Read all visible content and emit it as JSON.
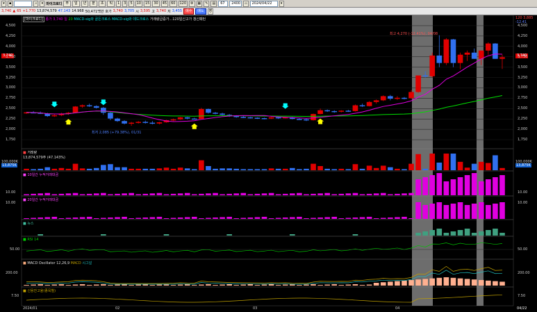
{
  "toolbar1": {
    "code": "",
    "stock_name": "마이크로디",
    "buttons": [
      "주",
      "일",
      "년",
      "분",
      "초",
      "틱"
    ],
    "periods": [
      "1",
      "3",
      "5",
      "10",
      "15",
      "30",
      "45",
      "60",
      "120"
    ],
    "count": "67",
    "count_unit": "2400",
    "date": "2024/04/22"
  },
  "toolbar2": {
    "price": "3,740",
    "change": "65",
    "change_pct": "+1.770",
    "volume": "13,874,579",
    "vol_ratio": "47.143",
    "amount": "14.968",
    "shares": "50,471백만",
    "hoga_label": "호가",
    "hoga": "3,740",
    "hoga2": "3,705",
    "high_label": "시",
    "high": "3,595",
    "low_label": "고",
    "low": "3,740",
    "close_label": "저",
    "close": "3,455",
    "buy_label": "매수",
    "sell_label": "매도",
    "misc_label": "영"
  },
  "price_pane": {
    "title_parts": [
      "[마이크로디]",
      "종가 3,740 일",
      "20",
      "MACD-sig와 골든크로스",
      "MACD-sig와 데드크로스",
      "거래량급증가...120일신고가 갱신패턴"
    ],
    "high_annot": "최고 4,270 (-12.41%), 04/08",
    "low_annot": "최저 2,085 (+79.38%), 01/31",
    "right_top_a": "120 3,885",
    "right_top_b": "-12.41",
    "last_price": "3,740",
    "yticks": [
      "4,500",
      "4,250",
      "4,000",
      "3,750",
      "3,500",
      "3,250",
      "3,000",
      "2,750",
      "2,500",
      "2,250",
      "2,000",
      "1,750"
    ],
    "colors": {
      "up": "#e00000",
      "down": "#3070f0",
      "ma_short": "#e000e0",
      "ma_long": "#00e000",
      "arrow_up": "#ffff00",
      "arrow_down": "#00ffff"
    }
  },
  "volume_pane": {
    "title": "거래량",
    "sub": "13,874,579주 (47.143%)",
    "tag_top": "100,000K",
    "tag_val": "13,875K"
  },
  "pane3": {
    "title": "10일간 누적거래대금",
    "ytick": "10.00"
  },
  "pane4": {
    "title": "20일간 누적거래대금",
    "ytick": "10.00"
  },
  "pane5": {
    "title": "뉴스"
  },
  "pane6": {
    "title": "RSI 14",
    "ytick": "50.00"
  },
  "pane7": {
    "title": "MACD Oscillator 12,26,9",
    "macd": "MACD",
    "signal": "시그널",
    "ytick": "200.00"
  },
  "pane8": {
    "title": "신용잔고율(종목별)",
    "ytick": "7.50"
  },
  "xaxis": {
    "labels": [
      "2024/01",
      "02",
      "03",
      "04",
      "04/22"
    ]
  },
  "chart_data": {
    "type": "candlestick",
    "candles": [
      [
        2390,
        2420,
        2370,
        2410
      ],
      [
        2410,
        2440,
        2390,
        2400
      ],
      [
        2400,
        2430,
        2370,
        2380
      ],
      [
        2380,
        2400,
        2300,
        2320
      ],
      [
        2320,
        2360,
        2300,
        2340
      ],
      [
        2340,
        2400,
        2320,
        2380
      ],
      [
        2380,
        2420,
        2350,
        2400
      ],
      [
        2400,
        2560,
        2390,
        2550
      ],
      [
        2550,
        2600,
        2520,
        2580
      ],
      [
        2580,
        2620,
        2540,
        2560
      ],
      [
        2560,
        2580,
        2500,
        2520
      ],
      [
        2520,
        2540,
        2350,
        2400
      ],
      [
        2400,
        2420,
        2220,
        2260
      ],
      [
        2260,
        2280,
        2180,
        2200
      ],
      [
        2200,
        2220,
        2120,
        2140
      ],
      [
        2140,
        2180,
        2085,
        2160
      ],
      [
        2160,
        2200,
        2140,
        2180
      ],
      [
        2180,
        2210,
        2140,
        2160
      ],
      [
        2160,
        2200,
        2120,
        2140
      ],
      [
        2140,
        2180,
        2120,
        2170
      ],
      [
        2170,
        2230,
        2160,
        2220
      ],
      [
        2220,
        2260,
        2200,
        2240
      ],
      [
        2240,
        2300,
        2230,
        2290
      ],
      [
        2290,
        2300,
        2240,
        2260
      ],
      [
        2260,
        2280,
        2240,
        2250
      ],
      [
        2250,
        2520,
        2250,
        2490
      ],
      [
        2490,
        2500,
        2380,
        2400
      ],
      [
        2400,
        2420,
        2360,
        2380
      ],
      [
        2380,
        2400,
        2340,
        2350
      ],
      [
        2350,
        2370,
        2300,
        2320
      ],
      [
        2320,
        2340,
        2280,
        2300
      ],
      [
        2300,
        2320,
        2270,
        2290
      ],
      [
        2290,
        2300,
        2260,
        2280
      ],
      [
        2280,
        2290,
        2250,
        2270
      ],
      [
        2270,
        2280,
        2240,
        2260
      ],
      [
        2260,
        2300,
        2250,
        2290
      ],
      [
        2290,
        2300,
        2250,
        2270
      ],
      [
        2270,
        2300,
        2260,
        2290
      ],
      [
        2290,
        2300,
        2240,
        2250
      ],
      [
        2250,
        2270,
        2230,
        2240
      ],
      [
        2240,
        2260,
        2200,
        2220
      ],
      [
        2220,
        2380,
        2210,
        2370
      ],
      [
        2370,
        2500,
        2360,
        2460
      ],
      [
        2460,
        2480,
        2420,
        2440
      ],
      [
        2440,
        2460,
        2400,
        2430
      ],
      [
        2430,
        2460,
        2410,
        2450
      ],
      [
        2450,
        2470,
        2420,
        2440
      ],
      [
        2440,
        2600,
        2430,
        2580
      ],
      [
        2580,
        2620,
        2540,
        2560
      ],
      [
        2560,
        2680,
        2550,
        2660
      ],
      [
        2660,
        2720,
        2620,
        2700
      ],
      [
        2700,
        2820,
        2680,
        2800
      ],
      [
        2800,
        2830,
        2700,
        2740
      ],
      [
        2740,
        2800,
        2710,
        2760
      ],
      [
        2760,
        2780,
        2720,
        2750
      ],
      [
        2750,
        2950,
        2730,
        2900
      ],
      [
        2900,
        3300,
        2880,
        3300
      ],
      [
        3300,
        3400,
        3250,
        3280
      ],
      [
        3280,
        3850,
        3250,
        3780
      ],
      [
        3780,
        4270,
        3500,
        3600
      ],
      [
        3600,
        4200,
        3550,
        4170
      ],
      [
        4170,
        4180,
        3500,
        3600
      ],
      [
        3600,
        3850,
        3450,
        3800
      ],
      [
        3800,
        3900,
        3650,
        3850
      ],
      [
        3850,
        3950,
        3700,
        3700
      ],
      [
        3700,
        3900,
        3550,
        3900
      ],
      [
        3900,
        4100,
        3800,
        4070
      ],
      [
        4070,
        4080,
        3700,
        3700
      ],
      [
        3700,
        3800,
        3455,
        3740
      ]
    ],
    "ylim": [
      1600,
      4650
    ]
  }
}
